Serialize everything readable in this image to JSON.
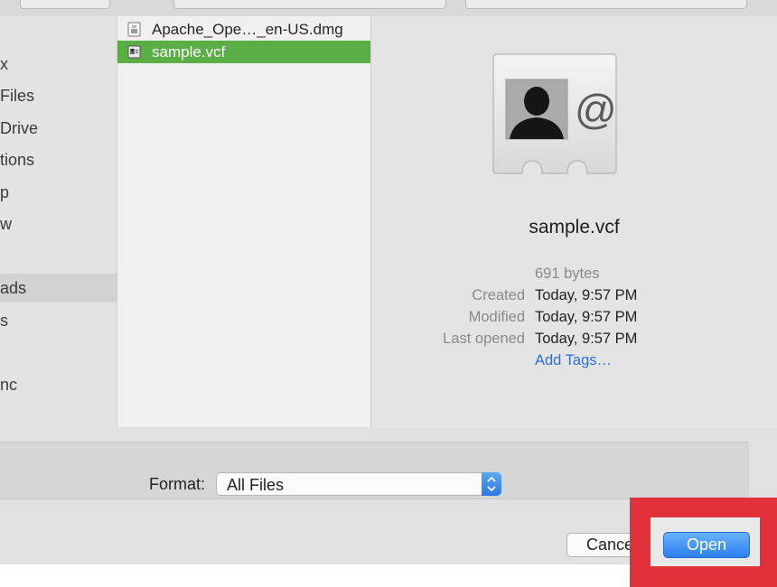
{
  "sidebar": {
    "items": [
      {
        "label": "x",
        "selected": false
      },
      {
        "label": "Files",
        "selected": false
      },
      {
        "label": "Drive",
        "selected": false
      },
      {
        "label": "tions",
        "selected": false
      },
      {
        "label": "p",
        "selected": false
      },
      {
        "label": "w",
        "selected": false
      },
      {
        "label": "",
        "selected": false
      },
      {
        "label": "ads",
        "selected": true
      },
      {
        "label": "s",
        "selected": false
      },
      {
        "label": "",
        "selected": false
      },
      {
        "label": "nc",
        "selected": false
      }
    ]
  },
  "files": [
    {
      "name": "Apache_Ope…_en-US.dmg",
      "icon": "disk-image-icon",
      "selected": false
    },
    {
      "name": "sample.vcf",
      "icon": "vcard-icon",
      "selected": true
    }
  ],
  "preview": {
    "icon": "contact-card-icon",
    "name": "sample.vcf",
    "size": "691 bytes",
    "meta": [
      {
        "key": "Created",
        "value": "Today, 9:57 PM"
      },
      {
        "key": "Modified",
        "value": "Today, 9:57 PM"
      },
      {
        "key": "Last opened",
        "value": "Today, 9:57 PM"
      }
    ],
    "add_tags": "Add Tags…"
  },
  "format": {
    "label": "Format:",
    "value": "All Files"
  },
  "buttons": {
    "cancel": "Cancel",
    "open": "Open"
  },
  "colors": {
    "selection": "#5aae45",
    "accent": "#2c7ff0",
    "highlight": "#e2313a",
    "link": "#2f6fd6"
  }
}
